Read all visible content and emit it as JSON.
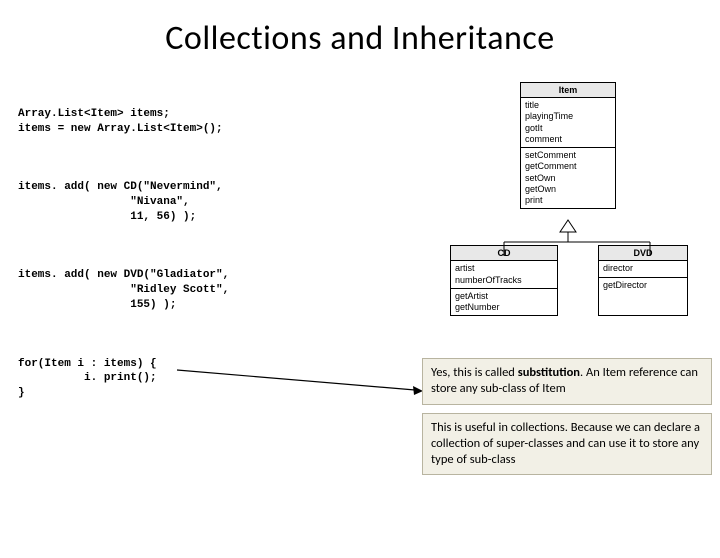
{
  "title": "Collections and Inheritance",
  "code": {
    "block1": "Array.List<Item> items;\nitems = new Array.List<Item>();",
    "block2": "items. add( new CD(\"Nevermind\",\n                 \"Nivana\",\n                 11, 56) );",
    "block3": "items. add( new DVD(\"Gladiator\",\n                 \"Ridley Scott\",\n                 155) );",
    "block4": "for(Item i : items) {\n          i. print();\n}"
  },
  "uml": {
    "item": {
      "name": "Item",
      "attrs": "title\nplayingTime\ngotIt\ncomment",
      "ops": "setComment\ngetComment\nsetOwn\ngetOwn\nprint"
    },
    "cd": {
      "name": "CD",
      "attrs": "artist\nnumberOfTracks",
      "ops": "getArtist\ngetNumber"
    },
    "dvd": {
      "name": "DVD",
      "attrs": "director",
      "ops": "getDirector"
    }
  },
  "notes": {
    "n1a": "Yes, this is called ",
    "n1b": "substitution",
    "n1c": ". An Item reference can store any sub-class of Item",
    "n2": "This is useful in collections. Because we can declare a collection of super-classes and can use it to store any type of sub-class"
  }
}
